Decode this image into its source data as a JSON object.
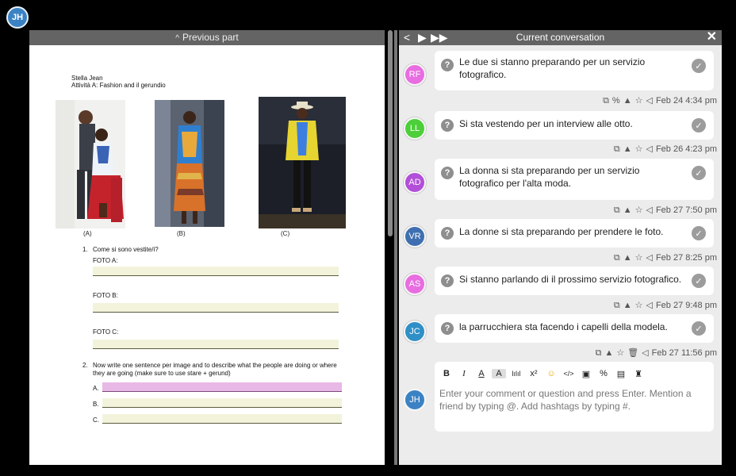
{
  "document": {
    "previous_part": "Previous part",
    "avatar": "JH",
    "student_name": "Stella Jean",
    "activity": "Attività A: Fashion and il gerundio",
    "captions": [
      "(A)",
      "(B)",
      "(C)"
    ],
    "q1": {
      "number": "1.",
      "text": "Come si sono vestite/i?",
      "labels": [
        "FOTO A:",
        "FOTO B:",
        "FOTO C:"
      ]
    },
    "q2": {
      "number": "2.",
      "text": "Now write one sentence per image and to describe what the people are doing or where they are going (make sure to use stare + gerund)",
      "labels": [
        "A.",
        "B.",
        "C."
      ]
    }
  },
  "conversation": {
    "title": "Current conversation",
    "nav": [
      "<",
      "▶",
      "▶▶"
    ],
    "close": "✕",
    "messages": [
      {
        "initials": "RF",
        "color": "#e86de0",
        "text": "Le due si stanno preparando per un servizio fotografico.",
        "date": "Feb 24 4:34 pm"
      },
      {
        "initials": "LL",
        "color": "#4dcf3a",
        "text": "Si sta vestendo per un interview alle otto.",
        "date": "Feb 26 4:23 pm"
      },
      {
        "initials": "AD",
        "color": "#b24fd8",
        "text": "La donna si sta preparando per un servizio fotografico per l'alta moda.",
        "date": "Feb 27 7:50 pm"
      },
      {
        "initials": "VR",
        "color": "#3f6fb0",
        "text": "La donne si sta preparando per prendere le foto.",
        "date": "Feb 27 8:25 pm"
      },
      {
        "initials": "AS",
        "color": "#e86de0",
        "text": "Si stanno parlando di il prossimo servizio fotografico.",
        "date": "Feb 27 9:48 pm"
      },
      {
        "initials": "JC",
        "color": "#2f8fc7",
        "text": "la parrucchiera sta facendo i capelli della modela.",
        "date": "Feb 27 11:56 pm"
      }
    ],
    "editor": {
      "avatar": "JH",
      "placeholder": "Enter your comment or question and press Enter. Mention a friend by typing @. Add hashtags by typing #.",
      "toolbar": [
        "B",
        "I",
        "A",
        "A",
        "lılıl",
        "x²",
        "☺",
        "</>",
        "▣",
        "%",
        "▤",
        "♜"
      ]
    }
  }
}
